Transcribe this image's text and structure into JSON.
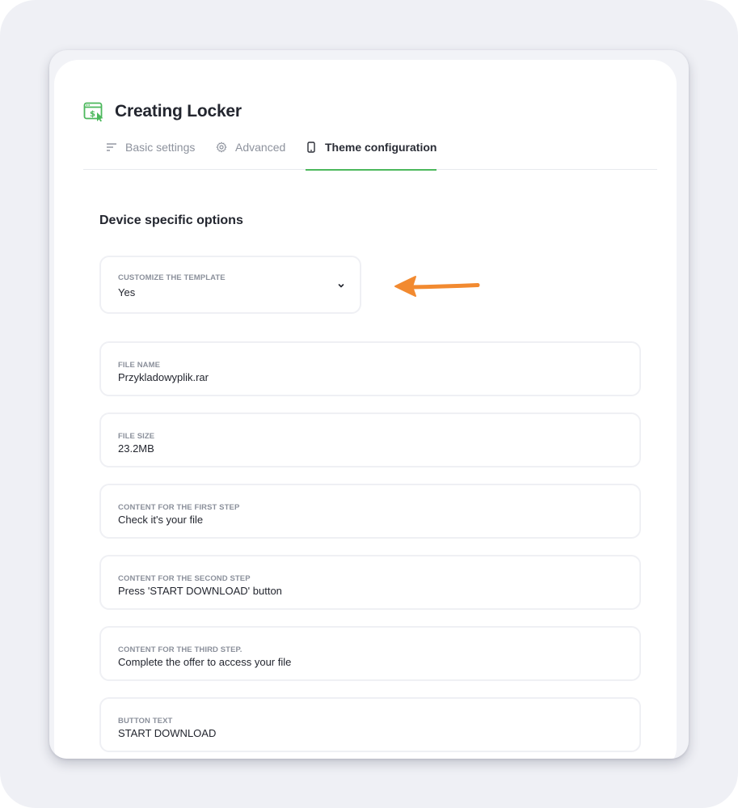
{
  "app": {
    "title": "Creating Locker"
  },
  "tabs": [
    {
      "label": "Basic settings",
      "icon": "sliders-lines-icon",
      "active": false
    },
    {
      "label": "Advanced",
      "icon": "gear-icon",
      "active": false
    },
    {
      "label": "Theme configuration",
      "icon": "phone-icon",
      "active": true
    }
  ],
  "section": {
    "title": "Device specific options"
  },
  "fields": {
    "customize_template": {
      "label": "CUSTOMIZE THE TEMPLATE",
      "value": "Yes"
    },
    "file_name": {
      "label": "FILE NAME",
      "value": "Przykladowyplik.rar"
    },
    "file_size": {
      "label": "FILE SIZE",
      "value": "23.2MB"
    },
    "first_step": {
      "label": "CONTENT FOR THE FIRST STEP",
      "value": "Check it's your file"
    },
    "second_step": {
      "label": "CONTENT FOR THE SECOND STEP",
      "value": "Press 'START DOWNLOAD' button"
    },
    "third_step": {
      "label": "CONTENT FOR THE THIRD STEP.",
      "value": "Complete the offer to access your file"
    },
    "button_text": {
      "label": "BUTTON TEXT",
      "value": "START DOWNLOAD"
    }
  },
  "colors": {
    "accent": "#4cb85c",
    "annotation_arrow": "#f28a30",
    "text_primary": "#23262f",
    "text_muted": "#8d929d"
  }
}
